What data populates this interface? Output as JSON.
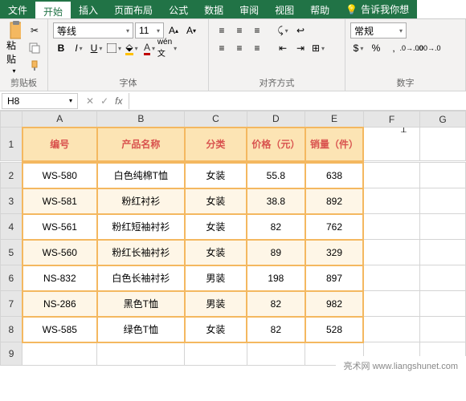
{
  "tabs": {
    "file": "文件",
    "home": "开始",
    "insert": "插入",
    "layout": "页面布局",
    "formula": "公式",
    "data": "数据",
    "review": "审阅",
    "view": "视图",
    "help": "帮助",
    "tell": "告诉我你想"
  },
  "groups": {
    "clipboard": "剪贴板",
    "font": "字体",
    "align": "对齐方式",
    "number": "数字"
  },
  "paste": "粘贴",
  "font": {
    "name": "等线",
    "size": "11"
  },
  "numfmt": "常规",
  "namebox": "H8",
  "formula_bar": "",
  "cols": [
    "A",
    "B",
    "C",
    "D",
    "E",
    "F",
    "G"
  ],
  "rows": [
    "1",
    "2",
    "3",
    "4",
    "5",
    "6",
    "7",
    "8",
    "9"
  ],
  "headers": [
    "编号",
    "产品名称",
    "分类",
    "价格（元）",
    "销量（件）"
  ],
  "chart_data": {
    "type": "table",
    "columns": [
      "编号",
      "产品名称",
      "分类",
      "价格（元）",
      "销量（件）"
    ],
    "rows": [
      [
        "WS-580",
        "白色纯棉T恤",
        "女装",
        55.8,
        638
      ],
      [
        "WS-581",
        "粉红衬衫",
        "女装",
        38.8,
        892
      ],
      [
        "WS-561",
        "粉红短袖衬衫",
        "女装",
        82,
        762
      ],
      [
        "WS-560",
        "粉红长袖衬衫",
        "女装",
        89,
        329
      ],
      [
        "NS-832",
        "白色长袖衬衫",
        "男装",
        198,
        897
      ],
      [
        "NS-286",
        "黑色T恤",
        "男装",
        82,
        982
      ],
      [
        "WS-585",
        "绿色T恤",
        "女装",
        82,
        528
      ]
    ]
  },
  "watermark": "亮术网 www.liangshunet.com"
}
